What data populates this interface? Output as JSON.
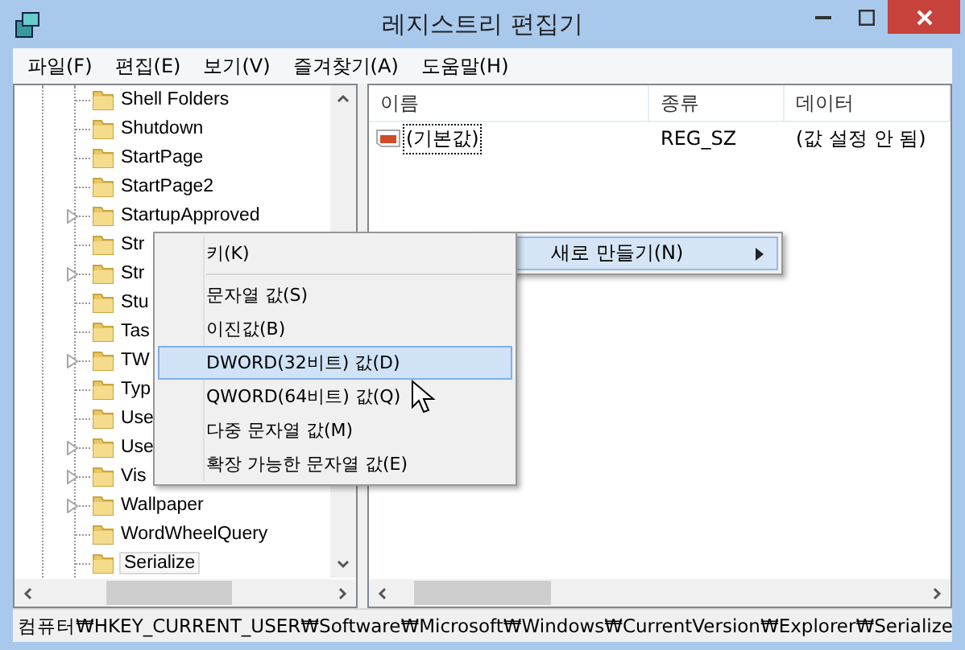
{
  "window": {
    "title": "레지스트리 편집기"
  },
  "menu_bar": [
    "파일(F)",
    "편집(E)",
    "보기(V)",
    "즐겨찾기(A)",
    "도움말(H)"
  ],
  "tree": {
    "items": [
      {
        "label": "Shell Folders",
        "expandable": false,
        "selected": false
      },
      {
        "label": "Shutdown",
        "expandable": false,
        "selected": false
      },
      {
        "label": "StartPage",
        "expandable": false,
        "selected": false
      },
      {
        "label": "StartPage2",
        "expandable": false,
        "selected": false
      },
      {
        "label": "StartupApproved",
        "expandable": true,
        "selected": false
      },
      {
        "label": "Str",
        "expandable": false,
        "selected": false
      },
      {
        "label": "Str",
        "expandable": true,
        "selected": false
      },
      {
        "label": "Stu",
        "expandable": false,
        "selected": false
      },
      {
        "label": "Tas",
        "expandable": false,
        "selected": false
      },
      {
        "label": "TW",
        "expandable": true,
        "selected": false
      },
      {
        "label": "Typ",
        "expandable": false,
        "selected": false
      },
      {
        "label": "Use",
        "expandable": false,
        "selected": false
      },
      {
        "label": "Use",
        "expandable": true,
        "selected": false
      },
      {
        "label": "Vis",
        "expandable": true,
        "selected": false
      },
      {
        "label": "Wallpaper",
        "expandable": true,
        "selected": false
      },
      {
        "label": "WordWheelQuery",
        "expandable": false,
        "selected": false
      },
      {
        "label": "Serialize",
        "expandable": false,
        "selected": true
      }
    ]
  },
  "values": {
    "columns": [
      "이름",
      "종류",
      "데이터"
    ],
    "rows": [
      {
        "name": "(기본값)",
        "type": "REG_SZ",
        "data": "(값 설정 안 됨)"
      }
    ]
  },
  "context_menu": {
    "label": "새로 만들기(N)"
  },
  "submenu": {
    "items": [
      {
        "label": "키(K)",
        "selected": false,
        "separator_after": true
      },
      {
        "label": "문자열 값(S)",
        "selected": false,
        "separator_after": false
      },
      {
        "label": "이진값(B)",
        "selected": false,
        "separator_after": false
      },
      {
        "label": "DWORD(32비트) 값(D)",
        "selected": true,
        "separator_after": false
      },
      {
        "label": "QWORD(64비트) 값(Q)",
        "selected": false,
        "separator_after": false
      },
      {
        "label": "다중 문자열 값(M)",
        "selected": false,
        "separator_after": false
      },
      {
        "label": "확장 가능한 문자열 값(E)",
        "selected": false,
        "separator_after": false
      }
    ]
  },
  "status_bar": "컴퓨터₩HKEY_CURRENT_USER₩Software₩Microsoft₩Windows₩CurrentVersion₩Explorer₩Serialize"
}
